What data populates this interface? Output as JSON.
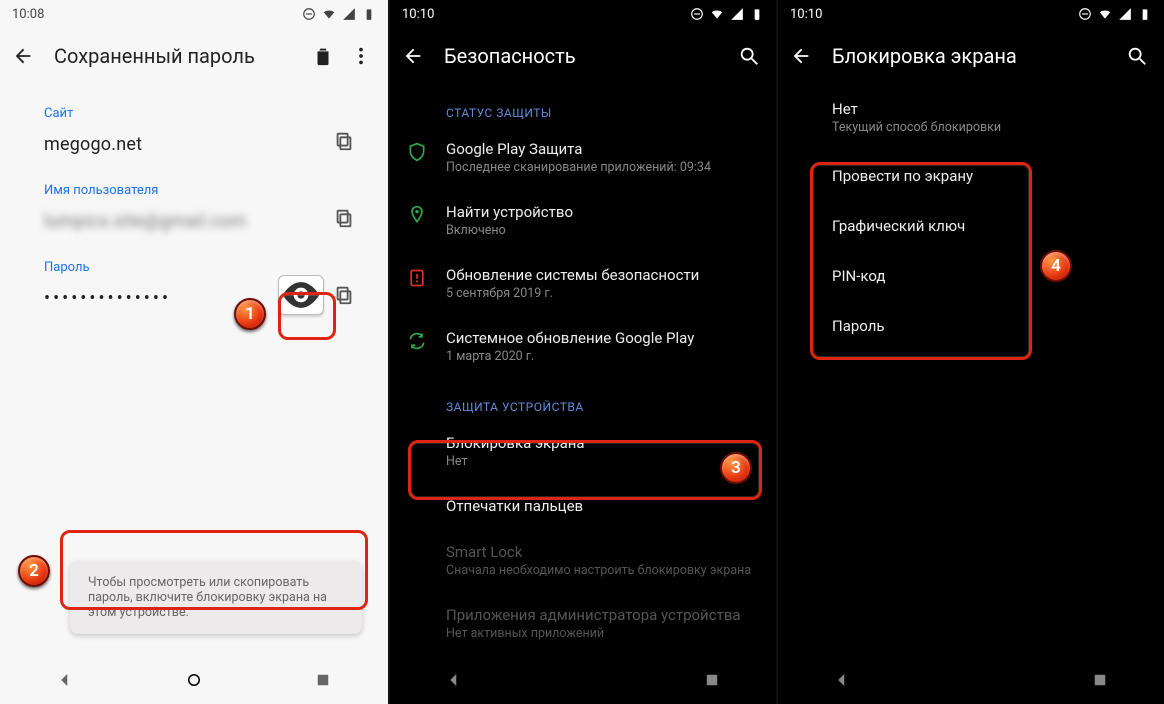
{
  "annotations": {
    "b1": "1",
    "b2": "2",
    "b3": "3",
    "b4": "4"
  },
  "panel1": {
    "time": "10:08",
    "title": "Сохраненный пароль",
    "site_label": "Сайт",
    "site_value": "megogo.net",
    "user_label": "Имя пользователя",
    "user_value": "lumpics.site@gmail.com",
    "password_label": "Пароль",
    "password_masked": "••••••••••••••",
    "toast": "Чтобы просмотреть или скопировать пароль, включите блокировку экрана на этом устройстве."
  },
  "panel2": {
    "time": "10:10",
    "title": "Безопасность",
    "section1": "СТАТУС ЗАЩИТЫ",
    "items1": [
      {
        "title": "Google Play Защита",
        "sub": "Последнее сканирование приложений: 09:34",
        "icon": "shield",
        "color": "#2faa4a"
      },
      {
        "title": "Найти устройство",
        "sub": "Включено",
        "icon": "pin",
        "color": "#2faa4a"
      },
      {
        "title": "Обновление системы безопасности",
        "sub": "5 сентября 2019 г.",
        "icon": "warn",
        "color": "#e03020"
      },
      {
        "title": "Системное обновление Google Play",
        "sub": "1 марта 2020 г.",
        "icon": "update",
        "color": "#2faa4a"
      }
    ],
    "section2": "ЗАЩИТА УСТРОЙСТВА",
    "items2": [
      {
        "title": "Блокировка экрана",
        "sub": "Нет"
      },
      {
        "title": "Отпечатки пальцев",
        "sub": ""
      },
      {
        "title": "Smart Lock",
        "sub": "Сначала необходимо настроить блокировку экрана",
        "dim": true
      },
      {
        "title": "Приложения администратора устройства",
        "sub": "Нет активных приложений",
        "dim": true
      }
    ]
  },
  "panel3": {
    "time": "10:10",
    "title": "Блокировка экрана",
    "current": {
      "title": "Нет",
      "sub": "Текущий способ блокировки"
    },
    "options": [
      {
        "title": "Провести по экрану"
      },
      {
        "title": "Графический ключ"
      },
      {
        "title": "PIN-код"
      },
      {
        "title": "Пароль"
      }
    ]
  }
}
